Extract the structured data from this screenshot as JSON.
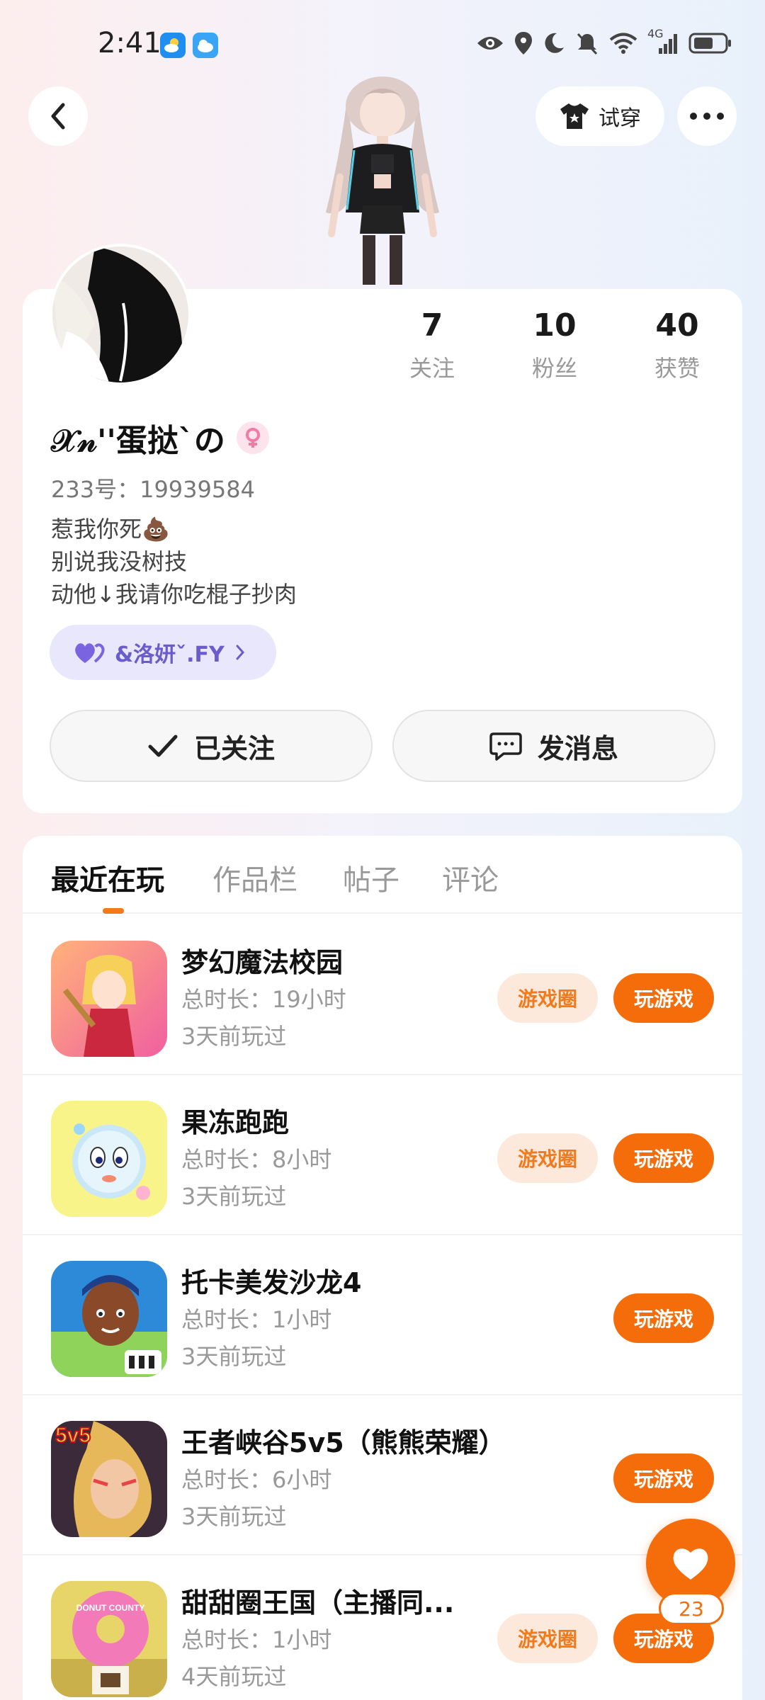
{
  "status_bar": {
    "time": "2:41",
    "network": "4G"
  },
  "header": {
    "tryon_label": "试穿"
  },
  "profile": {
    "stats": [
      {
        "value": "7",
        "label": "关注"
      },
      {
        "value": "10",
        "label": "粉丝"
      },
      {
        "value": "40",
        "label": "获赞"
      }
    ],
    "nickname": "𝒳𝓃''蛋挞`の",
    "user_id": "233号：19939584",
    "bio": [
      "惹我你死💩",
      "别说我没树技",
      "动他↓我请你吃棍子抄肉"
    ],
    "cp_tag": "&洛妍ˇ.FY",
    "follow_label": "已关注",
    "message_label": "发消息"
  },
  "tabs": [
    "最近在玩",
    "作品栏",
    "帖子",
    "评论"
  ],
  "games": [
    {
      "name": "梦幻魔法校园",
      "duration": "总时长：19小时",
      "last_played": "3天前玩过",
      "circle_label": "游戏圈",
      "play_label": "玩游戏"
    },
    {
      "name": "果冻跑跑",
      "duration": "总时长：8小时",
      "last_played": "3天前玩过",
      "circle_label": "游戏圈",
      "play_label": "玩游戏"
    },
    {
      "name": "托卡美发沙龙4",
      "duration": "总时长：1小时",
      "last_played": "3天前玩过",
      "circle_label": "",
      "play_label": "玩游戏"
    },
    {
      "name": "王者峡谷5v5（熊熊荣耀）",
      "duration": "总时长：6小时",
      "last_played": "3天前玩过",
      "circle_label": "",
      "play_label": "玩游戏",
      "icon_badge": "5v5"
    },
    {
      "name": "甜甜圈王国（主播同...",
      "duration": "总时长：1小时",
      "last_played": "4天前玩过",
      "circle_label": "游戏圈",
      "play_label": "玩游戏",
      "icon_badge": "DONUT COUNTY"
    }
  ],
  "floating_like": {
    "count": "23"
  },
  "colors": {
    "accent": "#f56d0b",
    "accent_light": "#fde9dc",
    "cp_purple": "#6a5ccc"
  }
}
